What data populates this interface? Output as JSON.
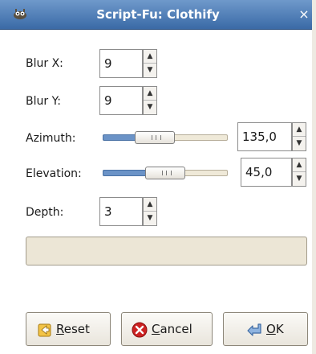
{
  "window": {
    "title": "Script-Fu: Clothify",
    "close_glyph": "×",
    "app_icon": "gimp-wilber-icon"
  },
  "params": {
    "blur_x": {
      "label": "Blur X:",
      "value": "9"
    },
    "blur_y": {
      "label": "Blur Y:",
      "value": "9"
    },
    "azimuth": {
      "label": "Azimuth:",
      "value": "135,0",
      "slider_fraction": 0.375
    },
    "elevation": {
      "label": "Elevation:",
      "value": "45,0",
      "slider_fraction": 0.5
    },
    "depth": {
      "label": "Depth:",
      "value": "3"
    }
  },
  "progress": {
    "text": ""
  },
  "buttons": {
    "reset": {
      "mnemonic": "R",
      "rest": "eset",
      "icon": "reset-icon"
    },
    "cancel": {
      "mnemonic": "C",
      "rest": "ancel",
      "icon": "cancel-icon"
    },
    "ok": {
      "mnemonic": "O",
      "rest": "K",
      "icon": "ok-return-icon"
    }
  },
  "colors": {
    "titlebar": "#4f7db8",
    "slider_fill": "#6b93c7",
    "cancel_icon": "#cc2222"
  }
}
